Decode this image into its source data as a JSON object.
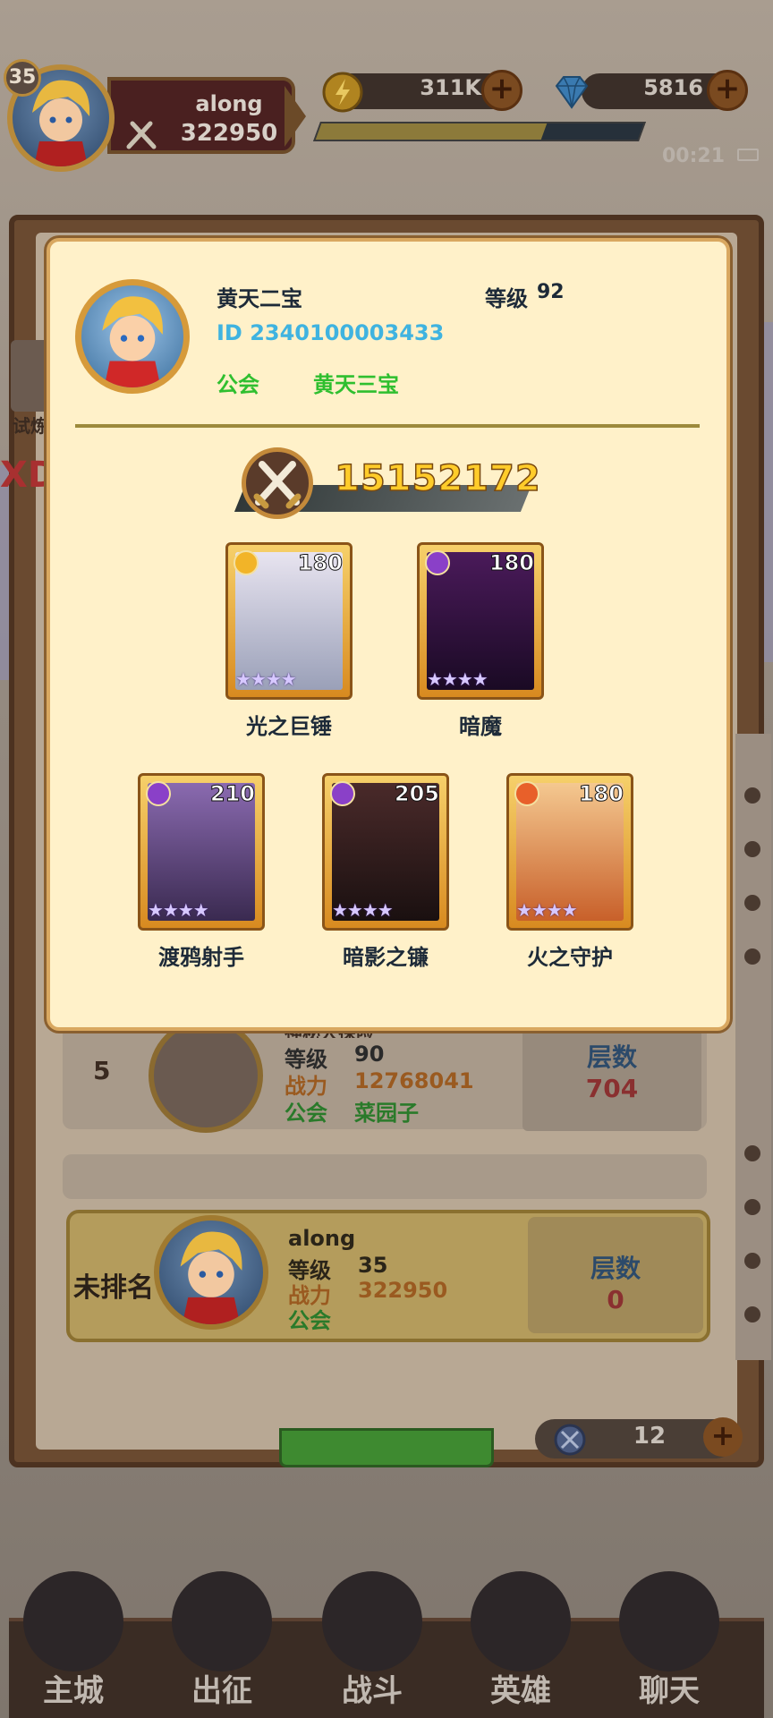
{
  "hud": {
    "level": "35",
    "player_name": "along",
    "power": "322950",
    "gold": "311K",
    "gems": "5816",
    "xp_fraction": 0.7,
    "time": "00:21"
  },
  "popup": {
    "name": "黄天二宝",
    "id_text": "ID 2340100003433",
    "guild_label": "公会",
    "guild_name": "黄天三宝",
    "level_label": "等级",
    "level": "92",
    "combat_power": "15152172",
    "heroes": [
      {
        "name": "光之巨锤",
        "level": "180",
        "stars": "★★★★",
        "element": "light",
        "color": "#f2b428"
      },
      {
        "name": "暗魔",
        "level": "180",
        "stars": "★★★★",
        "element": "dark",
        "color": "#8a40c8"
      },
      {
        "name": "渡鸦射手",
        "level": "210",
        "stars": "★★★★",
        "element": "dark",
        "color": "#8a40c8"
      },
      {
        "name": "暗影之镰",
        "level": "205",
        "stars": "★★★★",
        "element": "dark",
        "color": "#8a40c8"
      },
      {
        "name": "火之守护",
        "level": "180",
        "stars": "★★★★",
        "element": "fire",
        "color": "#e8602a"
      }
    ]
  },
  "background": {
    "left_tool_label": "试炼",
    "left_edge_text": "XD",
    "rank5": {
      "rank": "5",
      "name_partial": "神秘大探险",
      "level_label": "等级",
      "level": "90",
      "power_label": "战力",
      "power": "12768041",
      "guild_label": "公会",
      "guild": "菜园子",
      "score_label": "层数",
      "score": "704"
    },
    "self": {
      "rank": "未排名",
      "name": "along",
      "level_label": "等级",
      "level": "35",
      "power_label": "战力",
      "power": "322950",
      "guild_label": "公会",
      "score_label": "层数",
      "score": "0"
    },
    "tickets": "12"
  },
  "nav": [
    {
      "label": "主城",
      "icon": "castle-icon"
    },
    {
      "label": "出征",
      "icon": "red-gem-icon"
    },
    {
      "label": "战斗",
      "icon": "battle-shield-icon"
    },
    {
      "label": "英雄",
      "icon": "hero-crown-icon"
    },
    {
      "label": "聊天",
      "icon": "chat-bubble-icon"
    }
  ]
}
